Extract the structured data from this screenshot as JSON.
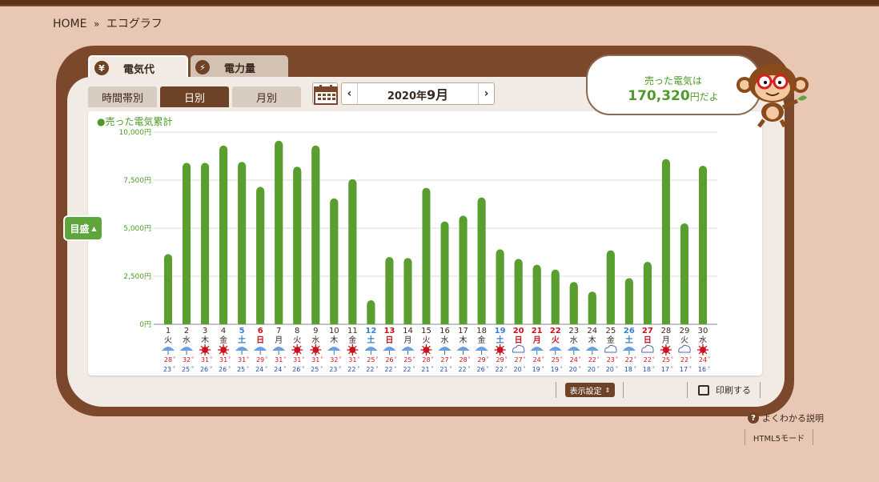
{
  "breadcrumb": {
    "home": "HOME",
    "separator": "»",
    "current": "エコグラフ"
  },
  "tabs": {
    "electricity": {
      "icon": "yen-icon",
      "glyph": "¥",
      "label": "電気代"
    },
    "power": {
      "icon": "lightning-icon",
      "glyph": "⚡",
      "label": "電力量"
    }
  },
  "subtabs": [
    "時間帯別",
    "日別",
    "月別"
  ],
  "active_subtab": "日別",
  "month_nav": {
    "prev": "‹",
    "year_label": "2020年",
    "month_label": "9月",
    "next": "›"
  },
  "bubble": {
    "line1": "売った電気は",
    "amount": "170,320",
    "suffix": "円だよ"
  },
  "legend": "●売った電気累計",
  "scale_button": "目盛",
  "display_settings": "表示設定",
  "print": "印刷する",
  "help": "よくわかる説明",
  "html5_mode": "HTML5モード",
  "colors": {
    "bar": "#5a9e2f",
    "weekday": "#3a2a20",
    "saturday": "#3a7fd0",
    "sunday_holiday": "#c8141e",
    "high_temp": "#c8141e",
    "low_temp": "#2a4fa0",
    "accent": "#6e4226"
  },
  "chart_data": {
    "type": "bar",
    "title": "",
    "ylabel": "",
    "ylim": [
      0,
      10000
    ],
    "y_ticks": [
      "0円",
      "2,500円",
      "5,000円",
      "7,500円",
      "10,000円"
    ],
    "categories": [
      "1",
      "2",
      "3",
      "4",
      "5",
      "6",
      "7",
      "8",
      "9",
      "10",
      "11",
      "12",
      "13",
      "14",
      "15",
      "16",
      "17",
      "18",
      "19",
      "20",
      "21",
      "22",
      "23",
      "24",
      "25",
      "26",
      "27",
      "28",
      "29",
      "30"
    ],
    "weekdays": [
      "火",
      "水",
      "木",
      "金",
      "土",
      "日",
      "月",
      "火",
      "水",
      "木",
      "金",
      "土",
      "日",
      "月",
      "火",
      "水",
      "木",
      "金",
      "土",
      "日",
      "月",
      "火",
      "水",
      "木",
      "金",
      "土",
      "日",
      "月",
      "火",
      "水"
    ],
    "day_type": [
      "w",
      "w",
      "w",
      "w",
      "sat",
      "sun",
      "w",
      "w",
      "w",
      "w",
      "w",
      "sat",
      "sun",
      "w",
      "w",
      "w",
      "w",
      "w",
      "sat",
      "sun",
      "hol",
      "hol",
      "w",
      "w",
      "w",
      "sat",
      "sun",
      "w",
      "w",
      "w"
    ],
    "values": [
      3650,
      8400,
      8400,
      9300,
      8450,
      7150,
      9550,
      8200,
      9300,
      6550,
      7550,
      1250,
      3500,
      3450,
      7100,
      5350,
      5650,
      6600,
      3900,
      3400,
      3100,
      2850,
      2200,
      1700,
      3850,
      2400,
      3250,
      8600,
      5250,
      8250
    ],
    "weather": [
      "rain",
      "rain",
      "sun",
      "sun",
      "rain",
      "rain",
      "rain",
      "sun",
      "sun",
      "rain",
      "sun",
      "rain",
      "rain",
      "rain",
      "sun",
      "rain",
      "rain",
      "rain",
      "sun",
      "cloud",
      "rain",
      "rain",
      "rain",
      "rain",
      "cloud",
      "rain",
      "cloud",
      "sun",
      "cloud",
      "sun"
    ],
    "high_temp": [
      "28",
      "32",
      "31",
      "31",
      "31",
      "29",
      "31",
      "31",
      "31",
      "32",
      "31",
      "25",
      "26",
      "25",
      "28",
      "27",
      "28",
      "29",
      "29",
      "27",
      "24",
      "25",
      "24",
      "22",
      "23",
      "22",
      "22",
      "25",
      "22",
      "24"
    ],
    "low_temp": [
      "23",
      "25",
      "26",
      "26",
      "25",
      "24",
      "24",
      "26",
      "25",
      "23",
      "22",
      "22",
      "22",
      "22",
      "21",
      "21",
      "22",
      "26",
      "22",
      "20",
      "19",
      "19",
      "20",
      "20",
      "20",
      "18",
      "18",
      "17",
      "17",
      "16"
    ]
  }
}
